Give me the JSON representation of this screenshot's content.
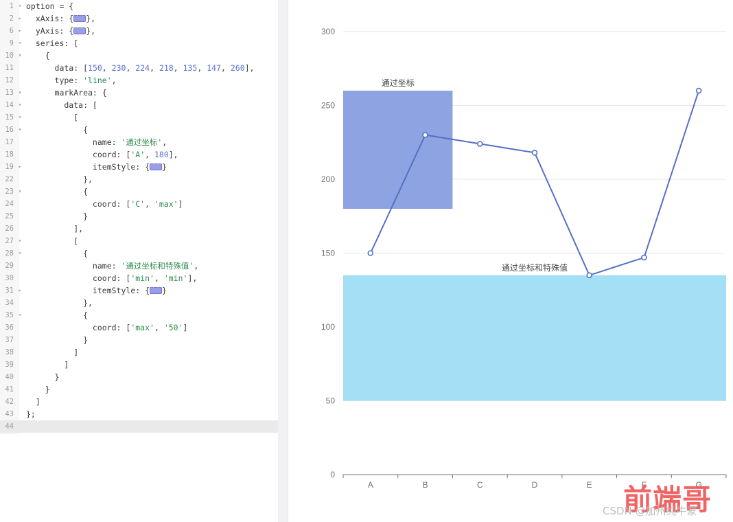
{
  "editor": {
    "name": "echarts-option-code-editor",
    "active_line": 44,
    "lines": [
      {
        "n": "1",
        "fold": "down",
        "text": "option = {"
      },
      {
        "n": "2",
        "fold": "right",
        "text": "  xAxis: {@},"
      },
      {
        "n": "6",
        "fold": "right",
        "text": "  yAxis: {@},"
      },
      {
        "n": "9",
        "fold": "down",
        "text": "  series: ["
      },
      {
        "n": "10",
        "fold": "down",
        "text": "    {"
      },
      {
        "n": "11",
        "fold": "",
        "text": "      data: [150, 230, 224, 218, 135, 147, 260],"
      },
      {
        "n": "12",
        "fold": "",
        "text": "      type: 'line',"
      },
      {
        "n": "13",
        "fold": "down",
        "text": "      markArea: {"
      },
      {
        "n": "14",
        "fold": "down",
        "text": "        data: ["
      },
      {
        "n": "15",
        "fold": "down",
        "text": "          ["
      },
      {
        "n": "16",
        "fold": "down",
        "text": "            {"
      },
      {
        "n": "17",
        "fold": "",
        "text": "              name: '通过坐标',"
      },
      {
        "n": "18",
        "fold": "",
        "text": "              coord: ['A', 180],"
      },
      {
        "n": "19",
        "fold": "right",
        "text": "              itemStyle: {@}"
      },
      {
        "n": "22",
        "fold": "",
        "text": "            },"
      },
      {
        "n": "23",
        "fold": "down",
        "text": "            {"
      },
      {
        "n": "24",
        "fold": "",
        "text": "              coord: ['C', 'max']"
      },
      {
        "n": "25",
        "fold": "",
        "text": "            }"
      },
      {
        "n": "26",
        "fold": "",
        "text": "          ],"
      },
      {
        "n": "27",
        "fold": "down",
        "text": "          ["
      },
      {
        "n": "28",
        "fold": "down",
        "text": "            {"
      },
      {
        "n": "29",
        "fold": "",
        "text": "              name: '通过坐标和特殊值',"
      },
      {
        "n": "30",
        "fold": "",
        "text": "              coord: ['min', 'min'],"
      },
      {
        "n": "31",
        "fold": "right",
        "text": "              itemStyle: {@}"
      },
      {
        "n": "34",
        "fold": "",
        "text": "            },"
      },
      {
        "n": "35",
        "fold": "down",
        "text": "            {"
      },
      {
        "n": "36",
        "fold": "",
        "text": "              coord: ['max', '50']"
      },
      {
        "n": "37",
        "fold": "",
        "text": "            }"
      },
      {
        "n": "38",
        "fold": "",
        "text": "          ]"
      },
      {
        "n": "39",
        "fold": "",
        "text": "        ]"
      },
      {
        "n": "40",
        "fold": "",
        "text": "      }"
      },
      {
        "n": "41",
        "fold": "",
        "text": "    }"
      },
      {
        "n": "42",
        "fold": "",
        "text": "  ]"
      },
      {
        "n": "43",
        "fold": "",
        "text": "};"
      },
      {
        "n": "44",
        "fold": "",
        "text": ""
      }
    ]
  },
  "chart_data": {
    "type": "line",
    "title": "",
    "xlabel": "",
    "ylabel": "",
    "categories": [
      "A",
      "B",
      "C",
      "D",
      "E",
      "F",
      "G"
    ],
    "series": [
      {
        "name": "line",
        "values": [
          150,
          230,
          224,
          218,
          135,
          147,
          260
        ],
        "color": "#5470c6"
      }
    ],
    "ylim": [
      0,
      300
    ],
    "yticks": [
      0,
      50,
      100,
      150,
      200,
      250,
      300
    ],
    "ytick_labels": [
      "0",
      "50",
      "100",
      "150",
      "200",
      "250",
      "300"
    ],
    "grid": true,
    "legend": "none",
    "mark_areas": [
      {
        "name": "通过坐标",
        "from": {
          "x": "A",
          "y": 180
        },
        "to": {
          "x": "C",
          "y": "max"
        },
        "y_from": 180,
        "y_to": 260,
        "color": "#8da3e2",
        "opacity": 1,
        "label_position": "top"
      },
      {
        "name": "通过坐标和特殊值",
        "from": {
          "x": "min",
          "y": "min"
        },
        "to": {
          "x": "max",
          "y": "50"
        },
        "y_from": 50,
        "y_to": 135,
        "color": "#a3dff5",
        "opacity": 1,
        "label_position": "top"
      }
    ],
    "axis_line_color": "#6e7079",
    "split_line_color": "#e0e6f1"
  },
  "watermark": {
    "main": "前端哥",
    "main_color": "#f04a4a",
    "sub": "CSDN @加州纯牛蒙",
    "sub_color": "#b8b8b8"
  }
}
